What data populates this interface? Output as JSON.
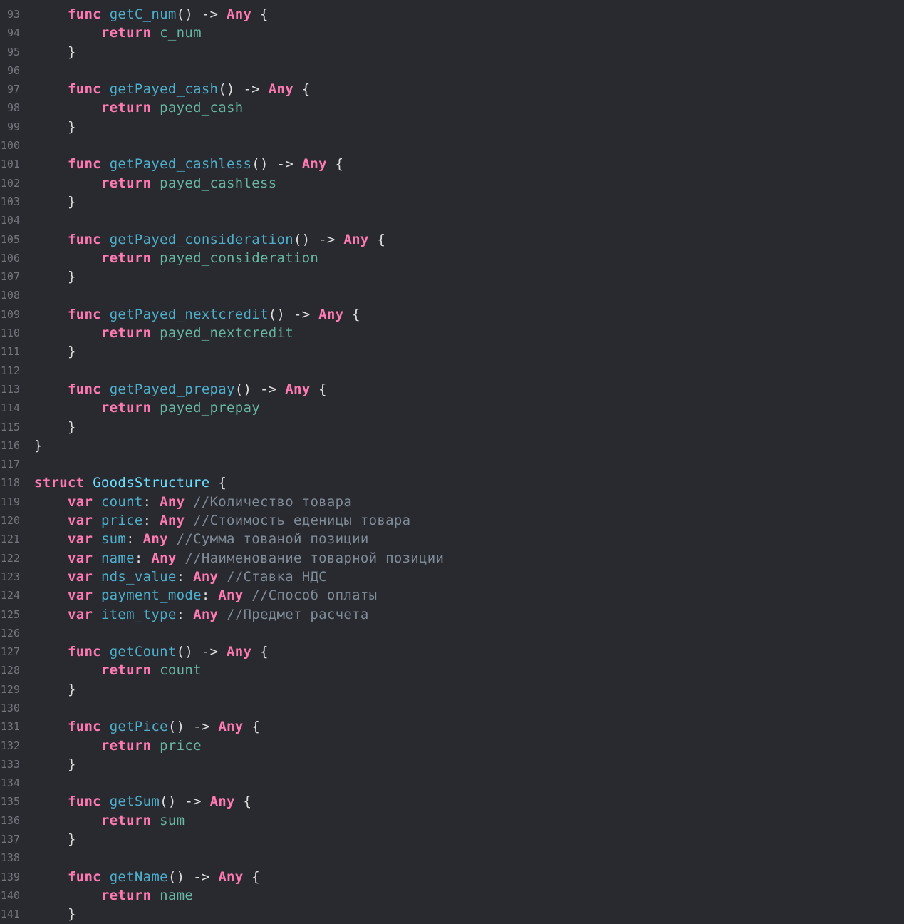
{
  "theme": {
    "background": "#292a30",
    "line_number": "#74757d",
    "keyword": "#ff7ab2",
    "function": "#4eb0cc",
    "type": "#6bdfff",
    "property": "#67b7a4",
    "comment": "#7f8c98",
    "plain": "#dfdfe0"
  },
  "lines": [
    {
      "n": "93",
      "tokens": [
        [
          "pl",
          "    "
        ],
        [
          "kw",
          "func"
        ],
        [
          "pl",
          " "
        ],
        [
          "fn",
          "getC_num"
        ],
        [
          "pl",
          "() -> "
        ],
        [
          "kw",
          "Any"
        ],
        [
          "pl",
          " {"
        ]
      ]
    },
    {
      "n": "94",
      "tokens": [
        [
          "pl",
          "        "
        ],
        [
          "kw",
          "return"
        ],
        [
          "pl",
          " "
        ],
        [
          "prop",
          "c_num"
        ]
      ]
    },
    {
      "n": "95",
      "tokens": [
        [
          "pl",
          "    }"
        ]
      ]
    },
    {
      "n": "96",
      "tokens": []
    },
    {
      "n": "97",
      "tokens": [
        [
          "pl",
          "    "
        ],
        [
          "kw",
          "func"
        ],
        [
          "pl",
          " "
        ],
        [
          "fn",
          "getPayed_cash"
        ],
        [
          "pl",
          "() -> "
        ],
        [
          "kw",
          "Any"
        ],
        [
          "pl",
          " {"
        ]
      ]
    },
    {
      "n": "98",
      "tokens": [
        [
          "pl",
          "        "
        ],
        [
          "kw",
          "return"
        ],
        [
          "pl",
          " "
        ],
        [
          "prop",
          "payed_cash"
        ]
      ]
    },
    {
      "n": "99",
      "tokens": [
        [
          "pl",
          "    }"
        ]
      ]
    },
    {
      "n": "100",
      "tokens": []
    },
    {
      "n": "101",
      "tokens": [
        [
          "pl",
          "    "
        ],
        [
          "kw",
          "func"
        ],
        [
          "pl",
          " "
        ],
        [
          "fn",
          "getPayed_cashless"
        ],
        [
          "pl",
          "() -> "
        ],
        [
          "kw",
          "Any"
        ],
        [
          "pl",
          " {"
        ]
      ]
    },
    {
      "n": "102",
      "tokens": [
        [
          "pl",
          "        "
        ],
        [
          "kw",
          "return"
        ],
        [
          "pl",
          " "
        ],
        [
          "prop",
          "payed_cashless"
        ]
      ]
    },
    {
      "n": "103",
      "tokens": [
        [
          "pl",
          "    }"
        ]
      ]
    },
    {
      "n": "104",
      "tokens": []
    },
    {
      "n": "105",
      "tokens": [
        [
          "pl",
          "    "
        ],
        [
          "kw",
          "func"
        ],
        [
          "pl",
          " "
        ],
        [
          "fn",
          "getPayed_consideration"
        ],
        [
          "pl",
          "() -> "
        ],
        [
          "kw",
          "Any"
        ],
        [
          "pl",
          " {"
        ]
      ]
    },
    {
      "n": "106",
      "tokens": [
        [
          "pl",
          "        "
        ],
        [
          "kw",
          "return"
        ],
        [
          "pl",
          " "
        ],
        [
          "prop",
          "payed_consideration"
        ]
      ]
    },
    {
      "n": "107",
      "tokens": [
        [
          "pl",
          "    }"
        ]
      ]
    },
    {
      "n": "108",
      "tokens": []
    },
    {
      "n": "109",
      "tokens": [
        [
          "pl",
          "    "
        ],
        [
          "kw",
          "func"
        ],
        [
          "pl",
          " "
        ],
        [
          "fn",
          "getPayed_nextcredit"
        ],
        [
          "pl",
          "() -> "
        ],
        [
          "kw",
          "Any"
        ],
        [
          "pl",
          " {"
        ]
      ]
    },
    {
      "n": "110",
      "tokens": [
        [
          "pl",
          "        "
        ],
        [
          "kw",
          "return"
        ],
        [
          "pl",
          " "
        ],
        [
          "prop",
          "payed_nextcredit"
        ]
      ]
    },
    {
      "n": "111",
      "tokens": [
        [
          "pl",
          "    }"
        ]
      ]
    },
    {
      "n": "112",
      "tokens": []
    },
    {
      "n": "113",
      "tokens": [
        [
          "pl",
          "    "
        ],
        [
          "kw",
          "func"
        ],
        [
          "pl",
          " "
        ],
        [
          "fn",
          "getPayed_prepay"
        ],
        [
          "pl",
          "() -> "
        ],
        [
          "kw",
          "Any"
        ],
        [
          "pl",
          " {"
        ]
      ]
    },
    {
      "n": "114",
      "tokens": [
        [
          "pl",
          "        "
        ],
        [
          "kw",
          "return"
        ],
        [
          "pl",
          " "
        ],
        [
          "prop",
          "payed_prepay"
        ]
      ]
    },
    {
      "n": "115",
      "tokens": [
        [
          "pl",
          "    }"
        ]
      ]
    },
    {
      "n": "116",
      "tokens": [
        [
          "pl",
          "}"
        ]
      ]
    },
    {
      "n": "117",
      "tokens": []
    },
    {
      "n": "118",
      "tokens": [
        [
          "kw",
          "struct"
        ],
        [
          "pl",
          " "
        ],
        [
          "ty",
          "GoodsStructure"
        ],
        [
          "pl",
          " {"
        ]
      ]
    },
    {
      "n": "119",
      "tokens": [
        [
          "pl",
          "    "
        ],
        [
          "kw",
          "var"
        ],
        [
          "pl",
          " "
        ],
        [
          "fn",
          "count"
        ],
        [
          "pl",
          ": "
        ],
        [
          "kw",
          "Any"
        ],
        [
          "pl",
          " "
        ],
        [
          "cm",
          "//Количество товара"
        ]
      ]
    },
    {
      "n": "120",
      "tokens": [
        [
          "pl",
          "    "
        ],
        [
          "kw",
          "var"
        ],
        [
          "pl",
          " "
        ],
        [
          "fn",
          "price"
        ],
        [
          "pl",
          ": "
        ],
        [
          "kw",
          "Any"
        ],
        [
          "pl",
          " "
        ],
        [
          "cm",
          "//Стоимость еденицы товара"
        ]
      ]
    },
    {
      "n": "121",
      "tokens": [
        [
          "pl",
          "    "
        ],
        [
          "kw",
          "var"
        ],
        [
          "pl",
          " "
        ],
        [
          "fn",
          "sum"
        ],
        [
          "pl",
          ": "
        ],
        [
          "kw",
          "Any"
        ],
        [
          "pl",
          " "
        ],
        [
          "cm",
          "//Сумма тованой позиции"
        ]
      ]
    },
    {
      "n": "122",
      "tokens": [
        [
          "pl",
          "    "
        ],
        [
          "kw",
          "var"
        ],
        [
          "pl",
          " "
        ],
        [
          "fn",
          "name"
        ],
        [
          "pl",
          ": "
        ],
        [
          "kw",
          "Any"
        ],
        [
          "pl",
          " "
        ],
        [
          "cm",
          "//Наименование товарной позиции"
        ]
      ]
    },
    {
      "n": "123",
      "tokens": [
        [
          "pl",
          "    "
        ],
        [
          "kw",
          "var"
        ],
        [
          "pl",
          " "
        ],
        [
          "fn",
          "nds_value"
        ],
        [
          "pl",
          ": "
        ],
        [
          "kw",
          "Any"
        ],
        [
          "pl",
          " "
        ],
        [
          "cm",
          "//Ставка НДС"
        ]
      ]
    },
    {
      "n": "124",
      "tokens": [
        [
          "pl",
          "    "
        ],
        [
          "kw",
          "var"
        ],
        [
          "pl",
          " "
        ],
        [
          "fn",
          "payment_mode"
        ],
        [
          "pl",
          ": "
        ],
        [
          "kw",
          "Any"
        ],
        [
          "pl",
          " "
        ],
        [
          "cm",
          "//Способ оплаты"
        ]
      ]
    },
    {
      "n": "125",
      "tokens": [
        [
          "pl",
          "    "
        ],
        [
          "kw",
          "var"
        ],
        [
          "pl",
          " "
        ],
        [
          "fn",
          "item_type"
        ],
        [
          "pl",
          ": "
        ],
        [
          "kw",
          "Any"
        ],
        [
          "pl",
          " "
        ],
        [
          "cm",
          "//Предмет расчета"
        ]
      ]
    },
    {
      "n": "126",
      "tokens": []
    },
    {
      "n": "127",
      "tokens": [
        [
          "pl",
          "    "
        ],
        [
          "kw",
          "func"
        ],
        [
          "pl",
          " "
        ],
        [
          "fn",
          "getCount"
        ],
        [
          "pl",
          "() -> "
        ],
        [
          "kw",
          "Any"
        ],
        [
          "pl",
          " {"
        ]
      ]
    },
    {
      "n": "128",
      "tokens": [
        [
          "pl",
          "        "
        ],
        [
          "kw",
          "return"
        ],
        [
          "pl",
          " "
        ],
        [
          "prop",
          "count"
        ]
      ]
    },
    {
      "n": "129",
      "tokens": [
        [
          "pl",
          "    }"
        ]
      ]
    },
    {
      "n": "130",
      "tokens": []
    },
    {
      "n": "131",
      "tokens": [
        [
          "pl",
          "    "
        ],
        [
          "kw",
          "func"
        ],
        [
          "pl",
          " "
        ],
        [
          "fn",
          "getPice"
        ],
        [
          "pl",
          "() -> "
        ],
        [
          "kw",
          "Any"
        ],
        [
          "pl",
          " {"
        ]
      ]
    },
    {
      "n": "132",
      "tokens": [
        [
          "pl",
          "        "
        ],
        [
          "kw",
          "return"
        ],
        [
          "pl",
          " "
        ],
        [
          "prop",
          "price"
        ]
      ]
    },
    {
      "n": "133",
      "tokens": [
        [
          "pl",
          "    }"
        ]
      ]
    },
    {
      "n": "134",
      "tokens": []
    },
    {
      "n": "135",
      "tokens": [
        [
          "pl",
          "    "
        ],
        [
          "kw",
          "func"
        ],
        [
          "pl",
          " "
        ],
        [
          "fn",
          "getSum"
        ],
        [
          "pl",
          "() -> "
        ],
        [
          "kw",
          "Any"
        ],
        [
          "pl",
          " {"
        ]
      ]
    },
    {
      "n": "136",
      "tokens": [
        [
          "pl",
          "        "
        ],
        [
          "kw",
          "return"
        ],
        [
          "pl",
          " "
        ],
        [
          "prop",
          "sum"
        ]
      ]
    },
    {
      "n": "137",
      "tokens": [
        [
          "pl",
          "    }"
        ]
      ]
    },
    {
      "n": "138",
      "tokens": []
    },
    {
      "n": "139",
      "tokens": [
        [
          "pl",
          "    "
        ],
        [
          "kw",
          "func"
        ],
        [
          "pl",
          " "
        ],
        [
          "fn",
          "getName"
        ],
        [
          "pl",
          "() -> "
        ],
        [
          "kw",
          "Any"
        ],
        [
          "pl",
          " {"
        ]
      ]
    },
    {
      "n": "140",
      "tokens": [
        [
          "pl",
          "        "
        ],
        [
          "kw",
          "return"
        ],
        [
          "pl",
          " "
        ],
        [
          "prop",
          "name"
        ]
      ]
    },
    {
      "n": "141",
      "tokens": [
        [
          "pl",
          "    }"
        ]
      ]
    }
  ]
}
